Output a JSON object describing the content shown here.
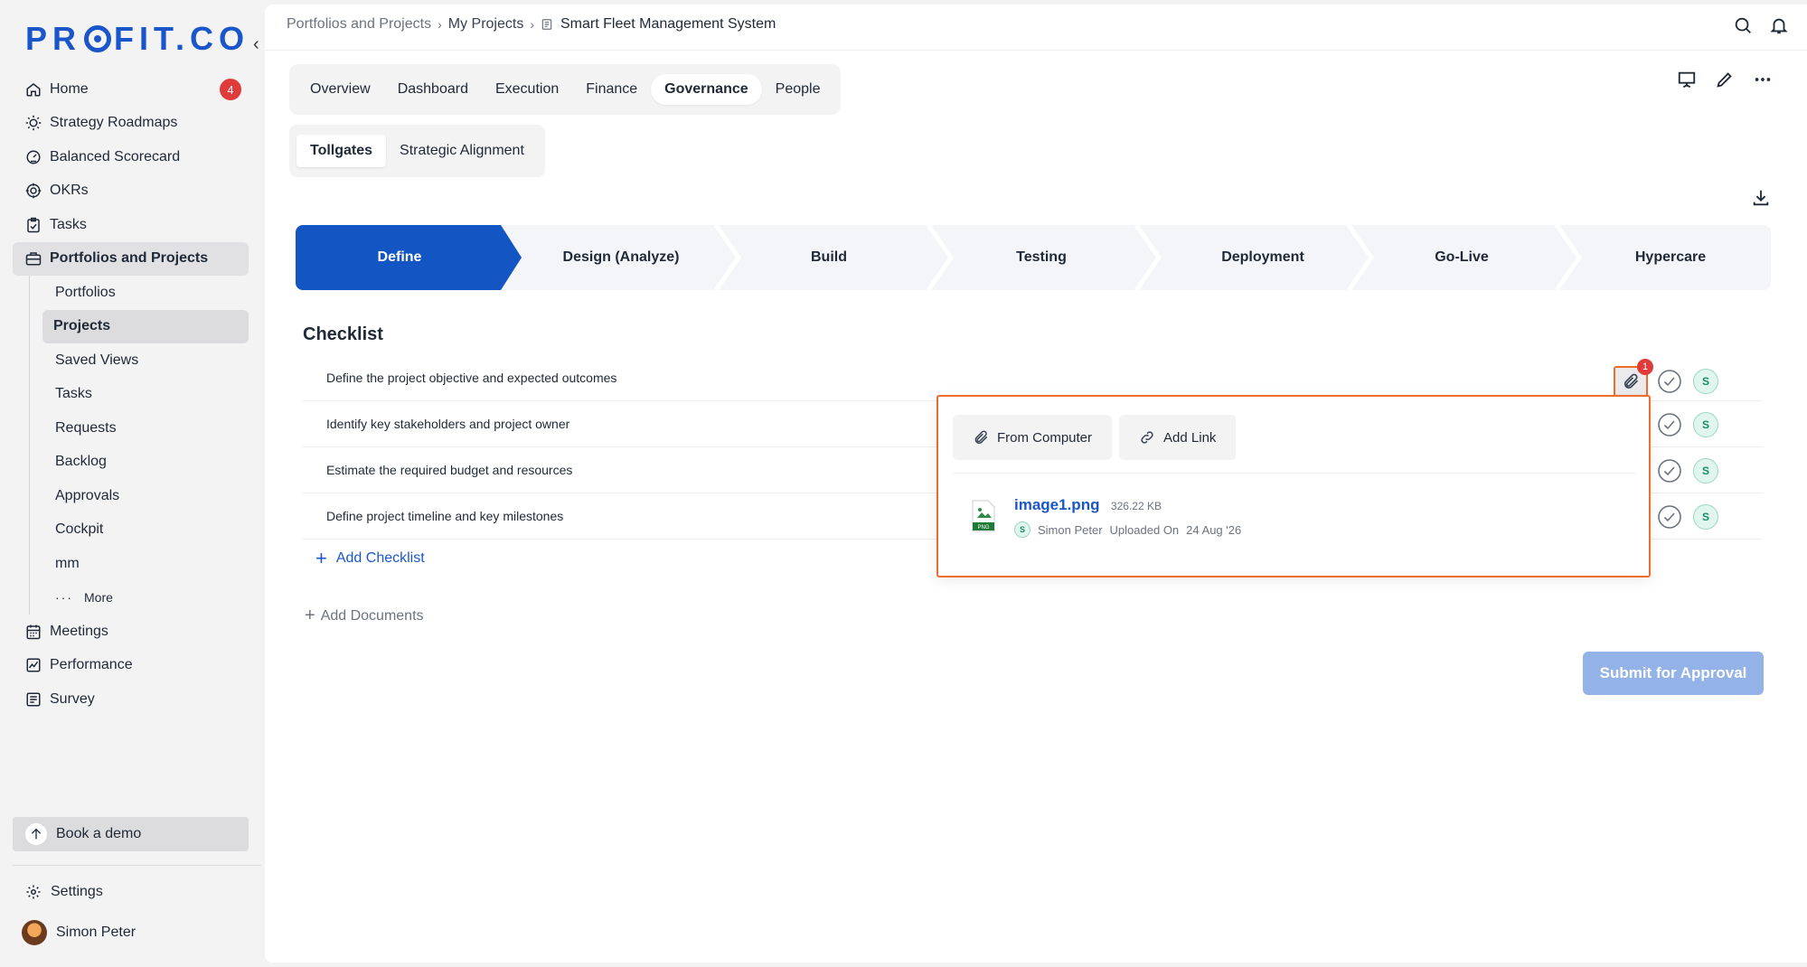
{
  "app": {
    "logo": "PR  FIT.CO",
    "logo_left": "PR",
    "logo_right": "FIT.CO"
  },
  "sidebar": {
    "items": [
      {
        "label": "Home",
        "icon": "home-icon",
        "badge": "4"
      },
      {
        "label": "Strategy Roadmaps",
        "icon": "bulb-icon"
      },
      {
        "label": "Balanced Scorecard",
        "icon": "gauge-icon"
      },
      {
        "label": "OKRs",
        "icon": "target-icon"
      },
      {
        "label": "Tasks",
        "icon": "clipboard-check-icon"
      },
      {
        "label": "Portfolios and Projects",
        "icon": "briefcase-icon",
        "active": true
      }
    ],
    "sub_items": [
      {
        "label": "Portfolios"
      },
      {
        "label": "Projects",
        "active": true
      },
      {
        "label": "Saved Views"
      },
      {
        "label": "Tasks"
      },
      {
        "label": "Requests"
      },
      {
        "label": "Backlog"
      },
      {
        "label": "Approvals"
      },
      {
        "label": "Cockpit"
      },
      {
        "label": "mm"
      },
      {
        "label": "More"
      }
    ],
    "bottom_items": [
      {
        "label": "Meetings",
        "icon": "calendar-icon"
      },
      {
        "label": "Performance",
        "icon": "chart-line-icon"
      },
      {
        "label": "Survey",
        "icon": "survey-icon"
      }
    ],
    "book_demo": "Book a demo",
    "settings": "Settings",
    "user": "Simon Peter"
  },
  "breadcrumb": {
    "items": [
      "Portfolios and Projects",
      "My Projects"
    ],
    "current": "Smart Fleet Management System"
  },
  "tabs": [
    "Overview",
    "Dashboard",
    "Execution",
    "Finance",
    "Governance",
    "People"
  ],
  "active_tab": "Governance",
  "subtabs": [
    "Tollgates",
    "Strategic Alignment"
  ],
  "active_subtab": "Tollgates",
  "stepper": {
    "steps": [
      "Define",
      "Design (Analyze)",
      "Build",
      "Testing",
      "Deployment",
      "Go-Live",
      "Hypercare"
    ],
    "active": "Define"
  },
  "checklist": {
    "title": "Checklist",
    "items": [
      "Define the project objective and expected outcomes",
      "Identify key stakeholders and project owner",
      "Estimate the required budget and resources",
      "Define project timeline and key milestones"
    ],
    "assignee_initial": "S",
    "attachment_count": "1",
    "add_label": "Add Checklist"
  },
  "add_documents": "Add Documents",
  "submit_label": "Submit for Approval",
  "attachment_popover": {
    "from_computer": "From Computer",
    "add_link": "Add Link",
    "file": {
      "name": "image1.png",
      "size": "326.22 KB",
      "uploader_initial": "S",
      "uploader": "Simon Peter",
      "uploaded_on_label": "Uploaded On",
      "date": "24 Aug '26",
      "type_label": "PNG"
    }
  },
  "colors": {
    "brand": "#1a56c9",
    "highlight": "#ef6c2f",
    "badge": "#e03b3b",
    "submit_disabled": "#93b3e8"
  }
}
